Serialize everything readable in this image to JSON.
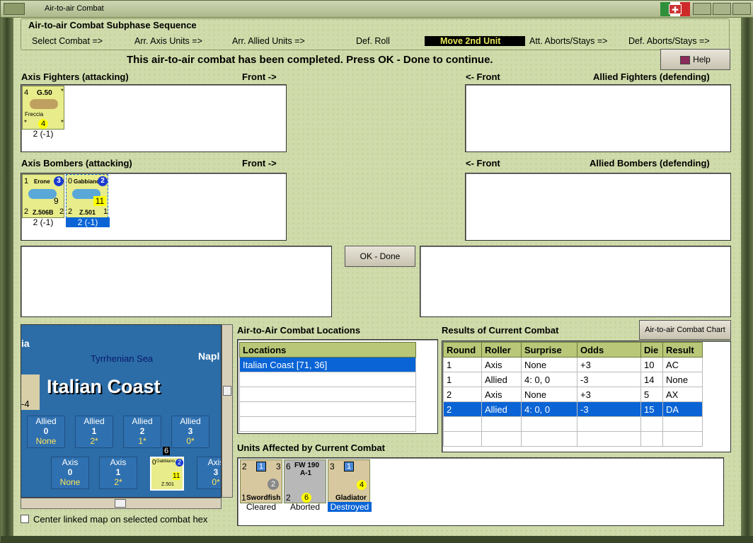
{
  "window": {
    "title": "Air-to-air Combat"
  },
  "sequence": {
    "header": "Air-to-air Combat Subphase Sequence",
    "steps": [
      "Select Combat =>",
      "Arr. Axis Units =>",
      "Arr. Allied Units =>",
      "Def. Roll",
      "Move 2nd Unit",
      "Att. Aborts/Stays =>",
      "Def. Aborts/Stays =>"
    ],
    "active_step": "Move 2nd Unit"
  },
  "message": "This air-to-air combat has been completed.  Press OK - Done to continue.",
  "help_button": "Help",
  "axis_fighters": {
    "label": "Axis Fighters (attacking)",
    "front": "Front ->",
    "units": [
      {
        "top_left": "4",
        "name": "G.50",
        "sub": "Freccia",
        "value": "4",
        "caption": "2 (-1)"
      }
    ]
  },
  "allied_fighters": {
    "label": "Allied Fighters (defending)",
    "front": "<- Front"
  },
  "axis_bombers": {
    "label": "Axis Bombers (attacking)",
    "front": "Front ->",
    "units": [
      {
        "top_left": "1",
        "name": "Erone",
        "badge": "3",
        "value": "9",
        "bottom_left": "2",
        "model": "Z.506B",
        "bottom_right": "2",
        "caption": "2 (-1)",
        "selected": false
      },
      {
        "top_left": "0",
        "name": "Gabbiano",
        "badge": "2",
        "value": "11",
        "bottom_left": "2",
        "model": "Z.501",
        "bottom_right": "1",
        "caption": "2 (-1)",
        "selected": true
      }
    ]
  },
  "allied_bombers": {
    "label": "Allied Bombers (defending)",
    "front": "<- Front"
  },
  "ok_done": "OK - Done",
  "map": {
    "sea": "Tyrrhenian Sea",
    "edge_left": "ia",
    "edge_right": "Napl",
    "title": "Italian Coast",
    "side_marker": "-4",
    "allied_boxes": [
      {
        "side": "Allied",
        "num": "0",
        "val": "None"
      },
      {
        "side": "Allied",
        "num": "1",
        "val": "2*"
      },
      {
        "side": "Allied",
        "num": "2",
        "val": "1*"
      },
      {
        "side": "Allied",
        "num": "3",
        "val": "0*"
      }
    ],
    "axis_boxes": [
      {
        "side": "Axis",
        "num": "0",
        "val": "None"
      },
      {
        "side": "Axis",
        "num": "1",
        "val": "2*"
      },
      {
        "side": "Axis",
        "num": "3",
        "val": "0*"
      }
    ],
    "stack_count": "6",
    "map_unit": {
      "top_left": "0",
      "name": "Gabbiano",
      "badge": "2",
      "value": "11",
      "model": "Z.501"
    }
  },
  "center_checkbox": "Center linked map on selected combat hex",
  "locations": {
    "title": "Air-to-Air Combat Locations",
    "header": "Locations",
    "rows": [
      "Italian Coast [71, 36]"
    ]
  },
  "results": {
    "title": "Results of Current Combat",
    "chart_button": "Air-to-air Combat Chart",
    "columns": [
      "Round",
      "Roller",
      "Surprise",
      "Odds",
      "Die",
      "Result"
    ],
    "rows": [
      [
        "1",
        "Axis",
        "None",
        "+3",
        "10",
        "AC"
      ],
      [
        "1",
        "Allied",
        "4: 0, 0",
        "-3",
        "14",
        "None"
      ],
      [
        "2",
        "Axis",
        "None",
        "+3",
        "5",
        "AX"
      ],
      [
        "2",
        "Allied",
        "4: 0, 0",
        "-3",
        "15",
        "DA"
      ]
    ],
    "selected_row": 3
  },
  "affected": {
    "title": "Units Affected by Current Combat",
    "units": [
      {
        "top_left": "2",
        "badge": "1",
        "top_right": "3",
        "circle": "2",
        "bottom_left": "1",
        "name": "Swordfish",
        "caption": "Cleared",
        "color": "tan"
      },
      {
        "top_left": "6",
        "name_top": "FW 190",
        "sub": "A-1",
        "bottom_left": "2",
        "value": "6",
        "caption": "Aborted",
        "color": "grey"
      },
      {
        "top_left": "3",
        "badge": "1",
        "value": "4",
        "name": "Gladiator",
        "caption": "Destroyed",
        "color": "tan",
        "selected": true
      }
    ]
  }
}
